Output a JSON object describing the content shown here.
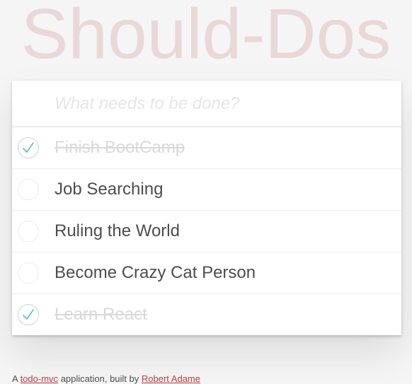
{
  "header": {
    "title": "Should-Dos"
  },
  "new_todo": {
    "placeholder": "What needs to be done?",
    "value": ""
  },
  "todos": [
    {
      "label": "Finish BootCamp",
      "completed": true
    },
    {
      "label": "Job Searching",
      "completed": false
    },
    {
      "label": "Ruling the World",
      "completed": false
    },
    {
      "label": "Become Crazy Cat Person",
      "completed": false
    },
    {
      "label": "Learn React",
      "completed": true
    }
  ],
  "footer": {
    "prefix": "A",
    "link1": "todo-mvc",
    "middle": "application, built by",
    "link2": "Robert Adame"
  },
  "colors": {
    "title": "#ead7d7",
    "check": "#5dc2af",
    "check_border": "#bddad5",
    "completed_text": "#d9d9d9",
    "link": "#b83f45"
  }
}
